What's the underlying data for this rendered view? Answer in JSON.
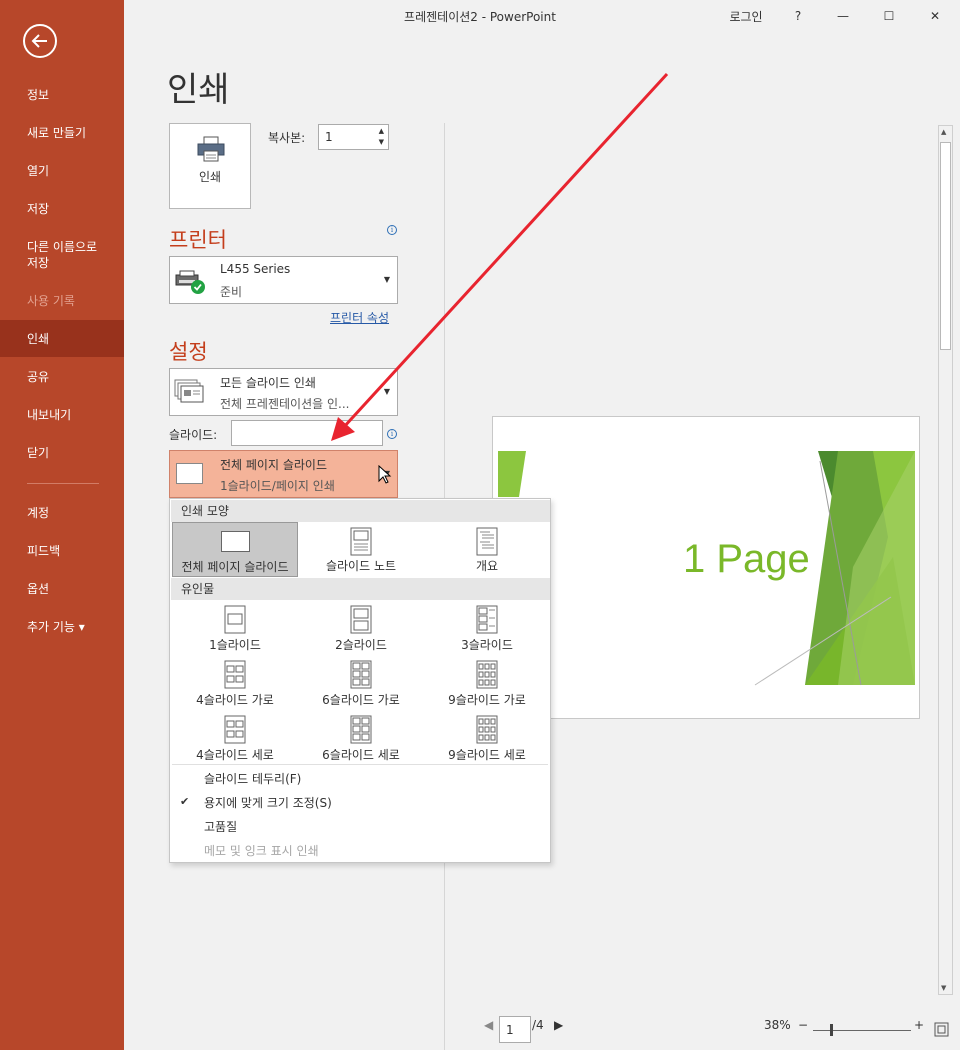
{
  "window": {
    "title": "프레젠테이션2  -  PowerPoint",
    "login": "로그인",
    "help": "?",
    "minimize": "—",
    "maximize": "☐",
    "close": "✕"
  },
  "sidebar": {
    "items": [
      {
        "label": "정보"
      },
      {
        "label": "새로 만들기"
      },
      {
        "label": "열기"
      },
      {
        "label": "저장"
      },
      {
        "label": "다른 이름으로\n저장"
      },
      {
        "label": "사용 기록"
      },
      {
        "label": "인쇄"
      },
      {
        "label": "공유"
      },
      {
        "label": "내보내기"
      },
      {
        "label": "닫기"
      },
      {
        "label": "계정"
      },
      {
        "label": "피드백"
      },
      {
        "label": "옵션"
      },
      {
        "label": "추가 기능 ▾"
      }
    ]
  },
  "main": {
    "title": "인쇄",
    "print_button": "인쇄",
    "copies_label": "복사본:",
    "copies_value": "1",
    "printer_heading": "프린터",
    "printer_name": "L455 Series",
    "printer_status": "준비",
    "printer_props": "프린터 속성",
    "settings_heading": "설정",
    "range_line1": "모든 슬라이드 인쇄",
    "range_line2": "전체 프레젠테이션을 인...",
    "slides_label": "슬라이드:",
    "slides_value": "",
    "layout_line1": "전체 페이지 슬라이드",
    "layout_line2": "1슬라이드/페이지 인쇄"
  },
  "menu": {
    "section1": "인쇄 모양",
    "layouts": [
      "전체 페이지 슬라이드",
      "슬라이드 노트",
      "개요"
    ],
    "section2": "유인물",
    "handouts": [
      "1슬라이드",
      "2슬라이드",
      "3슬라이드",
      "4슬라이드 가로",
      "6슬라이드 가로",
      "9슬라이드 가로",
      "4슬라이드 세로",
      "6슬라이드 세로",
      "9슬라이드 세로"
    ],
    "options": [
      {
        "label": "슬라이드 테두리(F)",
        "checked": false,
        "enabled": true
      },
      {
        "label": "용지에 맞게 크기 조정(S)",
        "checked": true,
        "enabled": true
      },
      {
        "label": "고품질",
        "checked": false,
        "enabled": true
      },
      {
        "label": "메모 및 잉크 표시 인쇄",
        "checked": false,
        "enabled": false
      }
    ]
  },
  "preview": {
    "slide_text": "1 Page",
    "page_current": "1",
    "page_total": "/4",
    "zoom": "38%"
  },
  "colors": {
    "accent": "#b7472a",
    "slide_green": "#7ab829"
  }
}
